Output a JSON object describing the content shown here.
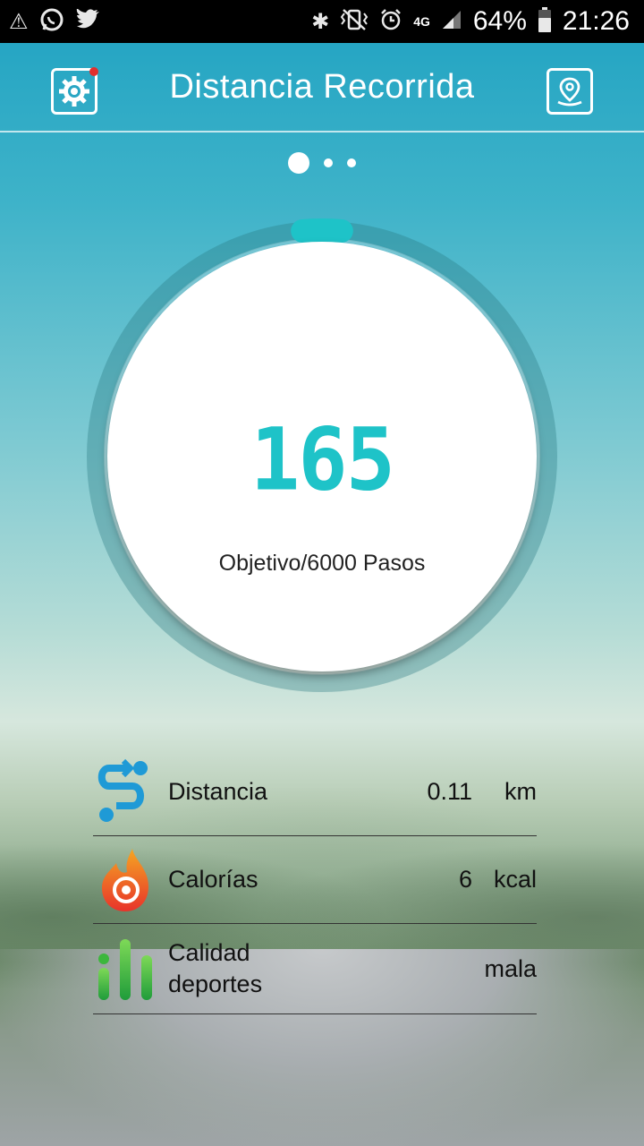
{
  "status_bar": {
    "battery": "64%",
    "time": "21:26",
    "network": "4G",
    "icons": [
      "alert-icon",
      "whatsapp-icon",
      "twitter-icon",
      "bluetooth-icon",
      "vibrate-icon",
      "alarm-icon",
      "signal-icon",
      "battery-icon"
    ]
  },
  "header": {
    "title": "Distancia Recorrida",
    "left_icon": "settings-icon",
    "right_icon": "location-icon"
  },
  "pager": {
    "total": 3,
    "active": 1
  },
  "steps": {
    "value": "165",
    "goal_label": "Objetivo/6000 Pasos",
    "progress": 0.0275
  },
  "stats": [
    {
      "icon": "distance-icon",
      "label": "Distancia",
      "value": "0.11",
      "unit": "km"
    },
    {
      "icon": "calories-icon",
      "label": "Calorías",
      "value": "6",
      "unit": "kcal"
    },
    {
      "icon": "quality-icon",
      "label": "Calidad\ndeportes",
      "value": "mala",
      "unit": ""
    }
  ],
  "colors": {
    "accent": "#1ec3c8",
    "distance_blue": "#1f9ad6",
    "calories_orange": "#e8542a",
    "quality_green": "#3cb73c"
  }
}
